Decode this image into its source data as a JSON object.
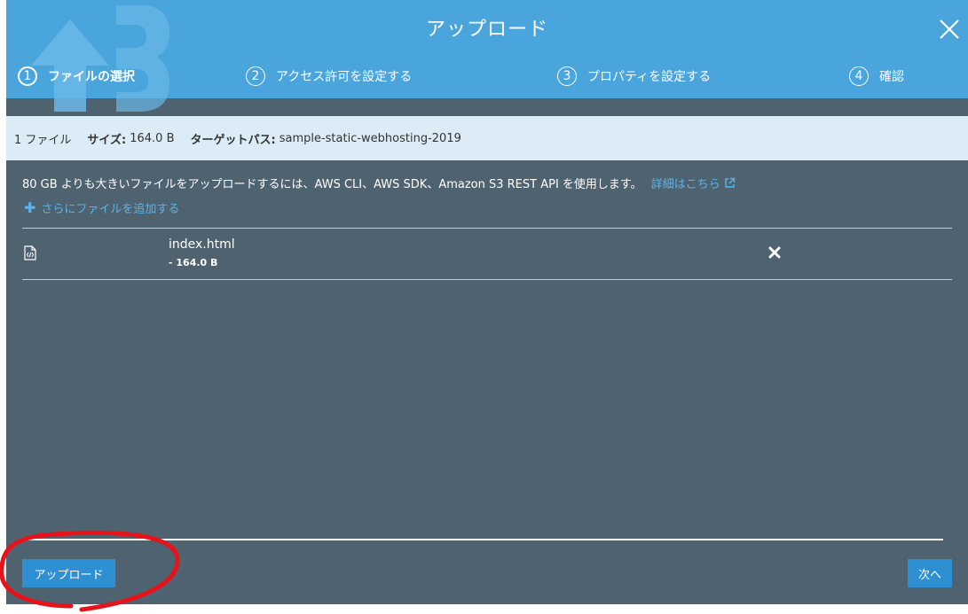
{
  "header": {
    "title": "アップロード",
    "close_icon": "close-icon",
    "bg_color": "#4aa5dd"
  },
  "steps": [
    {
      "num": "1",
      "label": "ファイルの選択",
      "active": true
    },
    {
      "num": "2",
      "label": "アクセス許可を設定する",
      "active": false
    },
    {
      "num": "3",
      "label": "プロパティを設定する",
      "active": false
    },
    {
      "num": "4",
      "label": "確認",
      "active": false
    }
  ],
  "info": {
    "file_count": "1 ファイル",
    "size_label": "サイズ:",
    "size_value": "164.0 B",
    "target_label": "ターゲットパス:",
    "target_value": "sample-static-webhosting-2019"
  },
  "notice": {
    "text": "80 GB よりも大きいファイルをアップロードするには、AWS CLI、AWS SDK、Amazon S3 REST API を使用します。",
    "link": "詳細はこちら"
  },
  "add_files": "さらにファイルを追加する",
  "files": [
    {
      "name": "index.html",
      "size": "- 164.0 B",
      "icon": "file-code-icon"
    }
  ],
  "footer": {
    "upload_label": "アップロード",
    "next_label": "次へ"
  },
  "colors": {
    "accent": "#2e8fd3",
    "link": "#5ab4ea",
    "panel": "#4f6270",
    "info_bar": "#dcecf6",
    "annotation": "#e8121a"
  }
}
